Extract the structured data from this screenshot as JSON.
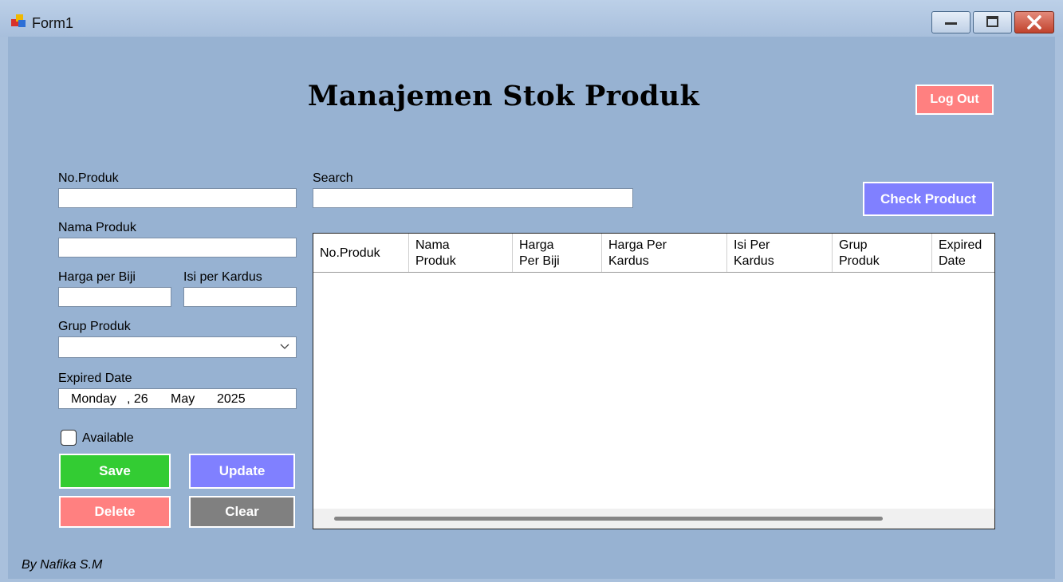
{
  "window": {
    "title": "Form1",
    "controls": {
      "minimize": "minimize-icon",
      "maximize": "maximize-icon",
      "close": "close-icon"
    }
  },
  "header": {
    "title": "Manajemen Stok Produk",
    "logout_label": "Log Out"
  },
  "form": {
    "no_produk_label": "No.Produk",
    "no_produk_value": "",
    "nama_produk_label": "Nama Produk",
    "nama_produk_value": "",
    "harga_biji_label": "Harga per Biji",
    "harga_biji_value": "",
    "isi_kardus_label": "Isi per Kardus",
    "isi_kardus_value": "",
    "grup_produk_label": "Grup Produk",
    "grup_produk_value": "",
    "expired_label": "Expired Date",
    "expired": {
      "weekday": "Monday",
      "day": ", 26",
      "month": "May",
      "year": "2025"
    },
    "available_label": "Available",
    "available_checked": false
  },
  "buttons": {
    "save": "Save",
    "update": "Update",
    "delete": "Delete",
    "clear": "Clear",
    "check": "Check Product"
  },
  "search": {
    "label": "Search",
    "value": ""
  },
  "grid": {
    "columns": [
      {
        "line1": "No.Produk",
        "line2": ""
      },
      {
        "line1": "Nama",
        "line2": "Produk"
      },
      {
        "line1": "Harga",
        "line2": "Per Biji"
      },
      {
        "line1": "Harga Per",
        "line2": "Kardus"
      },
      {
        "line1": "Isi Per",
        "line2": "Kardus"
      },
      {
        "line1": "Grup",
        "line2": "Produk"
      },
      {
        "line1": "Expired",
        "line2": "Date"
      }
    ],
    "rows": []
  },
  "footer": {
    "credit": "By Nafika S.M"
  },
  "colors": {
    "background": "#97b2d2",
    "save": "#33cc33",
    "update": "#8080ff",
    "delete": "#ff8080",
    "clear": "#808080",
    "check": "#8080ff",
    "logout": "#ff8080"
  }
}
